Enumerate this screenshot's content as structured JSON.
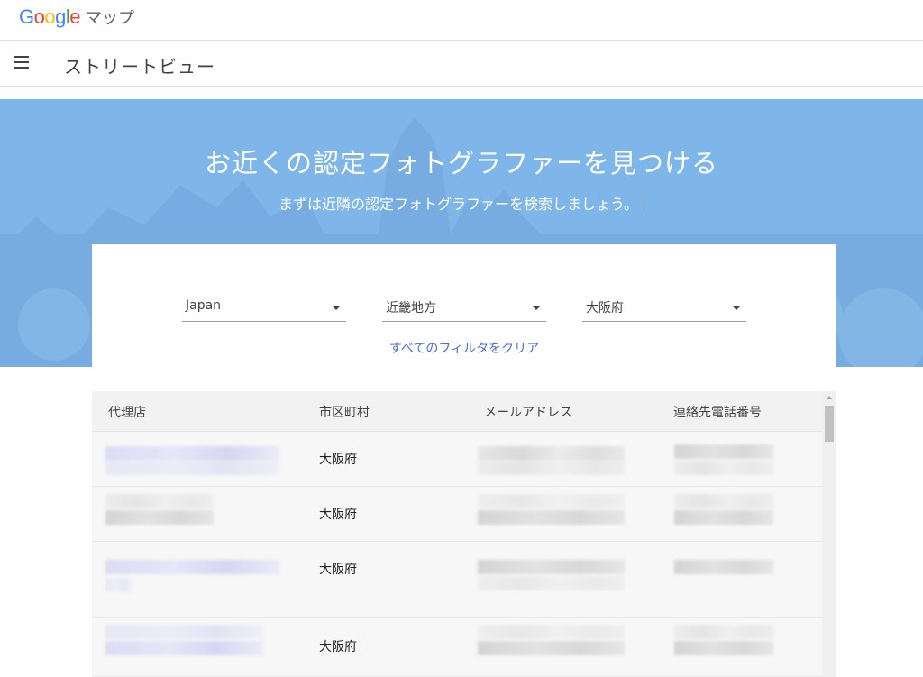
{
  "app": {
    "logo_letters": [
      "G",
      "o",
      "o",
      "g",
      "l",
      "e"
    ],
    "logo_colors": [
      "#4285F4",
      "#EA4335",
      "#FBBC05",
      "#4285F4",
      "#34A853",
      "#EA4335"
    ],
    "product": "マップ"
  },
  "subbar": {
    "menu_icon": "hamburger-menu-icon",
    "title": "ストリートビュー"
  },
  "hero": {
    "title": "お近くの認定フォトグラファーを見つける",
    "subtitle": "まずは近隣の認定フォトグラファーを検索しましょう。",
    "background_color": "#7fb6ea"
  },
  "filters": {
    "country": "Japan",
    "region": "近畿地方",
    "prefecture": "大阪府",
    "clear_label": "すべてのフィルタをクリア",
    "link_color": "#4a6fd6"
  },
  "table": {
    "headers": {
      "agent": "代理店",
      "city": "市区町村",
      "email": "メールアドレス",
      "phone": "連絡先電話番号"
    },
    "rows": [
      {
        "city": "大阪府"
      },
      {
        "city": "大阪府"
      },
      {
        "city": "大阪府"
      },
      {
        "city": "大阪府"
      }
    ]
  }
}
